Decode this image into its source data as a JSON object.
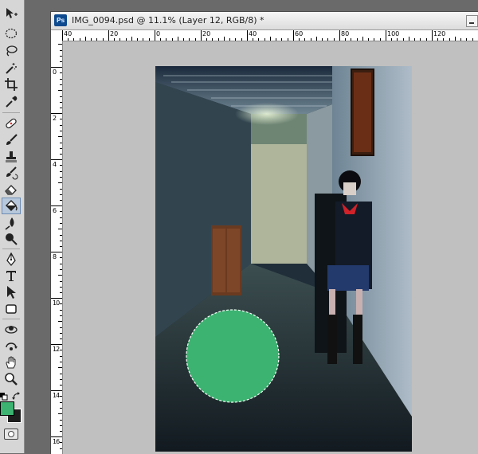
{
  "document": {
    "title": "IMG_0094.psd @ 11.1% (Layer 12, RGB/8) *",
    "app_badge": "Ps"
  },
  "rulers": {
    "top_labels": [
      "40",
      "20",
      "0",
      "20",
      "40",
      "60",
      "80",
      "100",
      "120"
    ],
    "left_labels": [
      "0",
      "2",
      "4",
      "6",
      "8",
      "10",
      "12",
      "14",
      "16"
    ]
  },
  "tools": [
    "move-icon",
    "marquee-icon",
    "lasso-icon",
    "magic-wand-icon",
    "crop-icon",
    "eyedropper-icon",
    "healing-brush-icon",
    "brush-icon",
    "clone-stamp-icon",
    "history-brush-icon",
    "eraser-icon",
    "paint-bucket-icon",
    "blur-icon",
    "dodge-icon",
    "pen-icon",
    "type-icon",
    "path-selection-icon",
    "shape-icon",
    "3d-rotate-icon",
    "3d-orbit-icon",
    "hand-icon",
    "zoom-icon"
  ],
  "active_tool": "paint-bucket-icon",
  "colors": {
    "foreground": "#3cb371",
    "background": "#1e1e1e"
  }
}
